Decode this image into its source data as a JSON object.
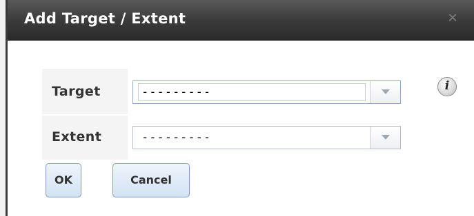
{
  "dialog": {
    "title": "Add Target / Extent",
    "close_icon": "close-x-icon"
  },
  "form": {
    "target": {
      "label": "Target",
      "value": "---------"
    },
    "extent": {
      "label": "Extent",
      "value": "---------"
    },
    "info_icon": "info-icon",
    "info_glyph": "i"
  },
  "buttons": {
    "ok_label": "OK",
    "cancel_label": "Cancel"
  },
  "colors": {
    "titlebar": "#3e3e3e",
    "button_border": "#7f9dc3",
    "button_fill": "#d3e2f3"
  }
}
